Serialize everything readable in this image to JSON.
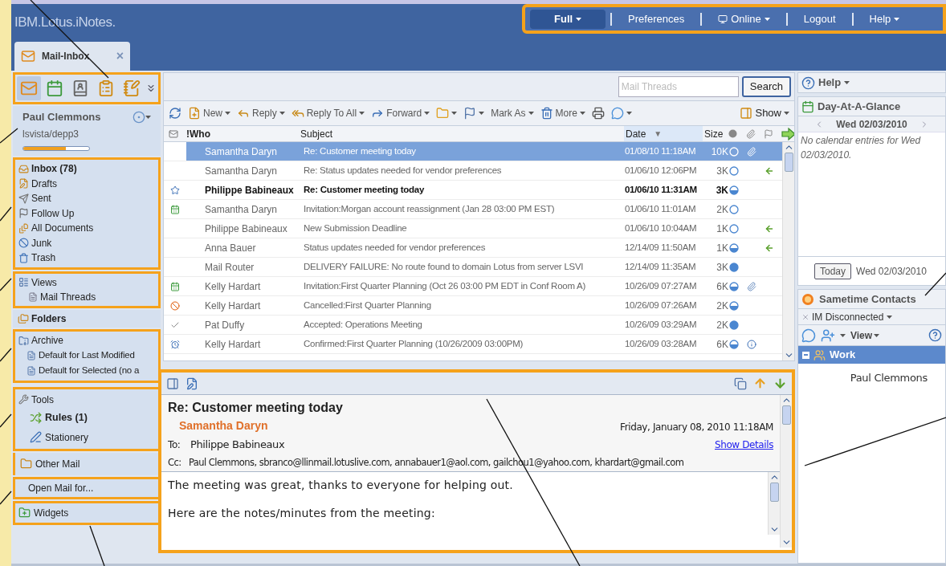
{
  "header": {
    "logo": "IBM.Lotus.iNotes.",
    "nav": [
      {
        "label": "Full",
        "dropdown": true,
        "selected": true,
        "kind": "menu"
      },
      {
        "label": "Preferences",
        "dropdown": false,
        "selected": false,
        "kind": "link"
      },
      {
        "label": "Online",
        "dropdown": true,
        "selected": false,
        "kind": "status"
      },
      {
        "label": "Logout",
        "dropdown": false,
        "selected": false,
        "kind": "link"
      },
      {
        "label": "Help",
        "dropdown": true,
        "selected": false,
        "kind": "menu"
      }
    ],
    "tabs": [
      {
        "label": "Mail-Inbox",
        "close": "×",
        "selected": true
      }
    ]
  },
  "sidebar": {
    "apps": [
      {
        "kind": "mail",
        "selected": true
      },
      {
        "kind": "calendar",
        "selected": false
      },
      {
        "kind": "contacts",
        "selected": false
      },
      {
        "kind": "todo",
        "selected": false
      },
      {
        "kind": "notebook",
        "selected": false
      }
    ],
    "profile": {
      "name": "Paul Clemmons",
      "server": "lsvista/depp3",
      "level": 0.65
    },
    "folders": [
      {
        "label": "Inbox (78)",
        "kind": "inbox",
        "bold": true
      },
      {
        "label": "Drafts",
        "kind": "drafts",
        "bold": false
      },
      {
        "label": "Sent",
        "kind": "sent",
        "bold": false
      },
      {
        "label": "Follow Up",
        "kind": "flag",
        "bold": false
      },
      {
        "label": "All Documents",
        "kind": "documents",
        "bold": false
      },
      {
        "label": "Junk",
        "kind": "junk",
        "bold": false
      },
      {
        "label": "Trash",
        "kind": "trash",
        "bold": false
      }
    ],
    "views": {
      "label": "Views",
      "children": [
        {
          "label": "Mail Threads"
        }
      ]
    },
    "folders_header": "Folders",
    "archive": {
      "label": "Archive",
      "children": [
        {
          "label": "Default for Last Modified"
        },
        {
          "label": "Default for Selected (no a"
        }
      ]
    },
    "tools": {
      "label": "Tools",
      "children": [
        {
          "label": "Rules (1)",
          "kind": "rules",
          "bold": true
        },
        {
          "label": "Stationery",
          "kind": "stationery",
          "bold": false
        }
      ]
    },
    "other_mail": {
      "label": "Other Mail",
      "children": [
        {
          "label": "Open Mail for..."
        }
      ]
    },
    "widgets": "Widgets"
  },
  "search": {
    "placeholder": "Mail Threads",
    "button": "Search"
  },
  "toolbar": [
    {
      "kind": "refresh",
      "dropdown": false
    },
    {
      "kind": "new",
      "label": "New",
      "dropdown": true
    },
    {
      "kind": "reply",
      "label": "Reply",
      "dropdown": true
    },
    {
      "kind": "reply_all",
      "label": "Reply To All",
      "dropdown": true
    },
    {
      "kind": "forward",
      "label": "Forward",
      "dropdown": true
    },
    {
      "kind": "folder",
      "dropdown": true
    },
    {
      "kind": "flag",
      "dropdown": true
    },
    {
      "kind": "text",
      "label": "Mark As",
      "dropdown": true
    },
    {
      "kind": "trash",
      "label": "More",
      "dropdown": true
    },
    {
      "kind": "print",
      "dropdown": false
    },
    {
      "kind": "chat",
      "dropdown": true
    },
    {
      "kind": "show",
      "label": "Show",
      "dropdown": true
    }
  ],
  "table": {
    "columns": [
      "!Who",
      "Subject",
      "Date",
      "Size"
    ],
    "sort_marker": "▼",
    "rows": [
      {
        "who": "Samantha Daryn",
        "subject": "Re: Customer meeting today",
        "date": "01/08/10 11:18AM",
        "size": "10K",
        "dot": {
          "kind": "empty"
        },
        "attachment": true,
        "info": false,
        "replied": false,
        "selected": true,
        "unread": false
      },
      {
        "who": "Samantha Daryn",
        "subject": "Re: Status updates needed for vendor preferences",
        "date": "01/06/10 12:06PM",
        "size": "3K",
        "dot": {
          "kind": "empty"
        },
        "attachment": false,
        "info": false,
        "replied": true,
        "selected": false,
        "unread": false
      },
      {
        "kind": "star",
        "who": "Philippe Babineaux",
        "subject": "Re: Customer meeting today",
        "date": "01/06/10 11:31AM",
        "size": "3K",
        "dot": {
          "kind": "half"
        },
        "attachment": false,
        "info": false,
        "replied": false,
        "selected": false,
        "unread": true
      },
      {
        "kind": "invitation",
        "who": "Samantha Daryn",
        "subject": "Invitation:Morgan account reassignment (Jan 28 03:00 PM EST)",
        "date": "01/06/10 11:01AM",
        "size": "2K",
        "dot": {
          "kind": "empty"
        },
        "attachment": false,
        "info": false,
        "replied": false,
        "selected": false,
        "unread": false
      },
      {
        "who": "Philippe Babineaux",
        "subject": "New Submission Deadline",
        "date": "01/06/10 10:04AM",
        "size": "1K",
        "dot": {
          "kind": "empty"
        },
        "attachment": false,
        "info": false,
        "replied": true,
        "selected": false,
        "unread": false
      },
      {
        "who": "Anna Bauer",
        "subject": "Status updates needed for vendor preferences",
        "date": "12/14/09 11:50AM",
        "size": "1K",
        "dot": {
          "kind": "half"
        },
        "attachment": false,
        "info": false,
        "replied": true,
        "selected": false,
        "unread": false
      },
      {
        "who": "Mail Router",
        "subject": "DELIVERY FAILURE: No route found to domain Lotus from server LSVI",
        "date": "12/14/09 11:35AM",
        "size": "3K",
        "dot": {
          "kind": "full"
        },
        "attachment": false,
        "info": false,
        "replied": false,
        "selected": false,
        "unread": false
      },
      {
        "kind": "invitation",
        "who": "Kelly Hardart",
        "subject": "Invitation:First Quarter Planning (Oct 26 03:00 PM EDT in Conf Room A)",
        "date": "10/26/09 07:27AM",
        "size": "6K",
        "dot": {
          "kind": "half"
        },
        "attachment": true,
        "info": false,
        "replied": false,
        "selected": false,
        "unread": false
      },
      {
        "kind": "cancelled",
        "who": "Kelly Hardart",
        "subject": "Cancelled:First Quarter Planning",
        "date": "10/26/09 07:26AM",
        "size": "2K",
        "dot": {
          "kind": "half"
        },
        "attachment": false,
        "info": false,
        "replied": false,
        "selected": false,
        "unread": false
      },
      {
        "kind": "accepted",
        "who": "Pat Duffy",
        "subject": "Accepted: Operations Meeting",
        "date": "10/26/09 03:29AM",
        "size": "2K",
        "dot": {
          "kind": "full"
        },
        "attachment": false,
        "info": false,
        "replied": false,
        "selected": false,
        "unread": false
      },
      {
        "kind": "confirmed",
        "who": "Kelly Hardart",
        "subject": "Confirmed:First Quarter Planning (10/26/2009 03:00PM)",
        "date": "10/26/09 03:28AM",
        "size": "6K",
        "dot": {
          "kind": "half"
        },
        "attachment": false,
        "info": true,
        "replied": false,
        "selected": false,
        "unread": false
      }
    ]
  },
  "preview": {
    "subject": "Re: Customer meeting today",
    "from": "Samantha Daryn",
    "sent": "Friday, January 08, 2010 11:18AM",
    "to_label": "To:",
    "to": "Philippe Babineaux",
    "details_link": "Show Details",
    "cc_label": "Cc:",
    "cc": "Paul Clemmons, sbranco@llinmail.lotuslive.com, annabauer1@aol.com, gailchou1@yahoo.com, khardart@gmail.com",
    "body": [
      "The meeting was great, thanks to everyone for helping out.",
      "Here are the notes/minutes from the meeting:"
    ]
  },
  "right": {
    "help": "Help",
    "day_at_a_glance": {
      "title": "Day-At-A-Glance",
      "date": "Wed 02/03/2010",
      "empty": "No calendar entries for Wed 02/03/2010.",
      "today_button": "Today",
      "today_date": "Wed 02/03/2010"
    },
    "sametime": {
      "title": "Sametime Contacts",
      "status": "IM Disconnected",
      "view": "View",
      "groups": [
        {
          "label": "Work",
          "expanded": true,
          "children": [
            {
              "label": "Paul Clemmons"
            }
          ]
        }
      ]
    }
  }
}
